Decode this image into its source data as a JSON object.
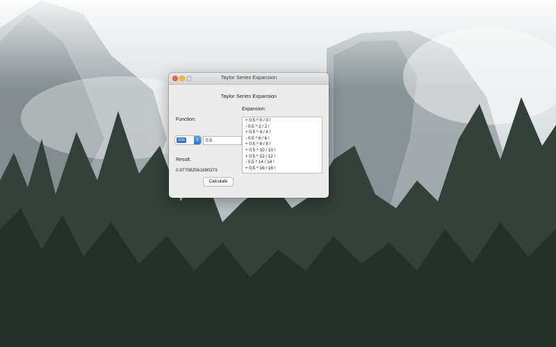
{
  "window": {
    "title": "Taylor Series Expansion"
  },
  "app": {
    "heading": "Taylor Series Expansion",
    "function_label": "Function:",
    "function_value": "cos",
    "input_value": "0.5",
    "result_label": "Result:",
    "result_value": "0.877582561890373",
    "calculate_label": "Calculate",
    "expansion_label": "Expansion:",
    "expansion_lines": [
      "+ 0.5 ^ 0 / 0 !",
      "- 0.5 ^ 2 / 2 !",
      "+ 0.5 ^ 4 / 4 !",
      "- 0.5 ^ 6 / 6 !",
      "+ 0.5 ^ 8 / 8 !",
      "+ 0.5 ^ 10 / 10 !",
      "+ 0.5 ^ 12 / 12 !",
      "- 0.5 ^ 14 / 14 !",
      "+ 0.5 ^ 16 / 16 !"
    ]
  },
  "colors": {
    "close": "#fc5f57",
    "minimize": "#fdbc2e",
    "select_accent": "#2f6fd9"
  },
  "icons": {
    "close": "close-icon",
    "minimize": "minimize-icon",
    "maximize": "maximize-icon",
    "dropdown": "chevron-updown-icon"
  }
}
